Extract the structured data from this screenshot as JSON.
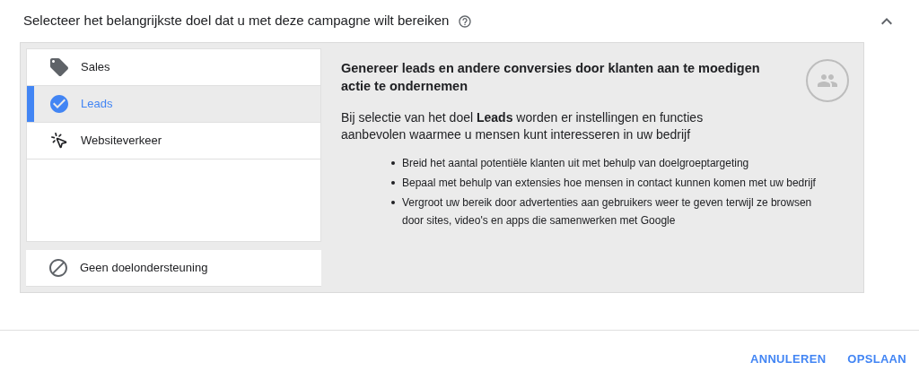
{
  "heading": "Selecteer het belangrijkste doel dat u met deze campagne wilt bereiken",
  "expanded": true,
  "goals": [
    {
      "label": "Sales",
      "selected": false
    },
    {
      "label": "Leads",
      "selected": true
    },
    {
      "label": "Websiteverkeer",
      "selected": false
    }
  ],
  "no_goal": {
    "label": "Geen doelondersteuning",
    "selected": false
  },
  "detail": {
    "title": "Genereer leads en andere conversies door klanten aan te moedigen actie te ondernemen",
    "description": "Bij selectie van het doel **Leads** worden er instellingen en functies aanbevolen waarmee u mensen kunt interesseren in uw bedrijf",
    "bullets": [
      "Breid het aantal potentiële klanten uit met behulp van doelgroeptargeting",
      "Bepaal met behulp van extensies hoe mensen in contact kunnen komen met uw bedrijf",
      "Vergroot uw bereik door advertenties aan gebruikers weer te geven terwijl ze browsen door sites, video's en apps die samenwerken met Google"
    ]
  },
  "buttons": [
    "ANNULEREN",
    "OPSLAAN"
  ]
}
